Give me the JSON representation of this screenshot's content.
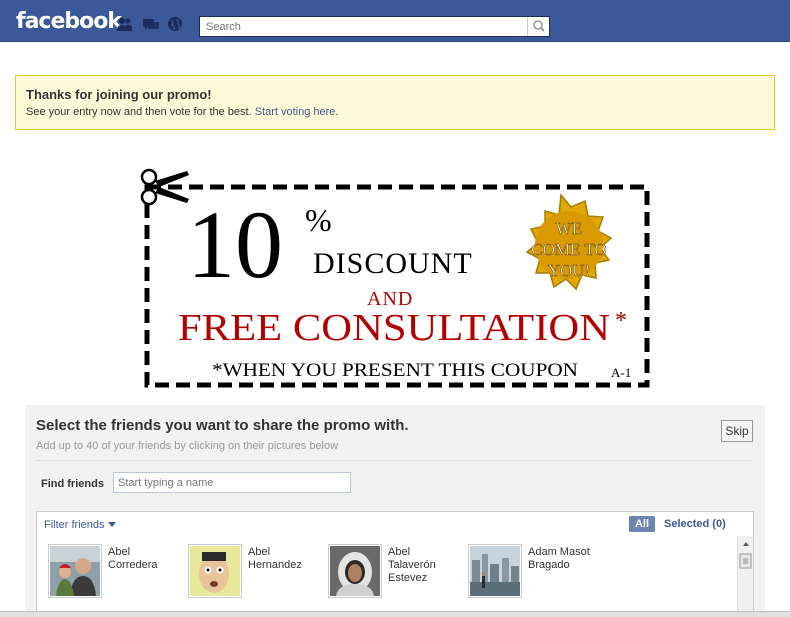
{
  "header": {
    "logo": "facebook",
    "search_placeholder": "Search"
  },
  "notice": {
    "title": "Thanks for joining our promo!",
    "text": "See your entry now and then vote for the best.",
    "link": "Start voting here."
  },
  "coupon": {
    "big_number": "10",
    "percent": "%",
    "discount": "DISCOUNT",
    "and": "AND",
    "free_consultation": "FREE CONSULTATION",
    "asterisk": "*",
    "badge_line1": "WE",
    "badge_line2": "COME TO",
    "badge_line3": "YOU!",
    "footnote": "*WHEN YOU PRESENT THIS COUPON",
    "code": "A-1"
  },
  "share": {
    "title": "Select the friends you want to share the promo with.",
    "subtitle": "Add up to 40 of your friends by clicking on their pictures below",
    "skip_label": "Skip",
    "find_label": "Find friends",
    "find_placeholder": "Start typing a name",
    "filter_label": "Filter friends",
    "tab_all": "All",
    "tab_selected": "Selected (0)",
    "friends": [
      {
        "name_line1": "Abel",
        "name_line2": "Corredera",
        "name_line3": ""
      },
      {
        "name_line1": "Abel",
        "name_line2": "Hernandez",
        "name_line3": ""
      },
      {
        "name_line1": "Abel",
        "name_line2": "Talaverón",
        "name_line3": "Estevez"
      },
      {
        "name_line1": "Adam Masot",
        "name_line2": "Bragado",
        "name_line3": ""
      }
    ]
  },
  "colors": {
    "brand": "#3b5998",
    "notice_bg": "#fff9d7",
    "coupon_red": "#b30000",
    "badge_gold": "#e0a800"
  }
}
